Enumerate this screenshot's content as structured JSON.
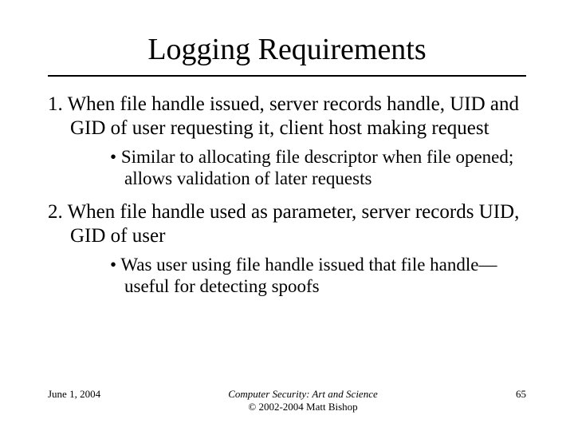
{
  "title": "Logging Requirements",
  "items": [
    {
      "text": "When file handle issued, server records handle, UID and GID of user requesting it, client host making request",
      "sub": "Similar to allocating file descriptor when file opened; allows validation of later requests"
    },
    {
      "text": "When file handle used as parameter, server records UID, GID of user",
      "sub": "Was user using file handle issued that file handle—useful for detecting spoofs"
    }
  ],
  "footer": {
    "date": "June 1, 2004",
    "book": "Computer Security: Art and Science",
    "copyright": "© 2002-2004 Matt Bishop",
    "page": "65"
  }
}
